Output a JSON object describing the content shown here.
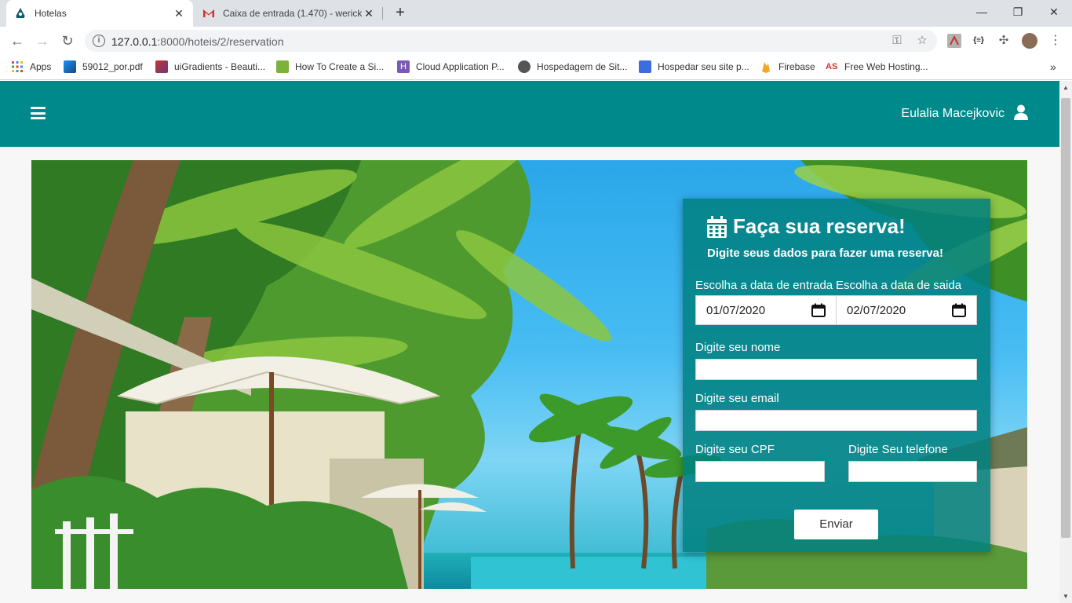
{
  "browser": {
    "tabs": [
      {
        "title": "Hotelas",
        "icon": "hotel-favicon-icon",
        "active": true
      },
      {
        "title": "Caixa de entrada (1.470) - werick",
        "icon": "gmail-favicon-icon",
        "active": false
      }
    ],
    "new_tab": "+",
    "url": {
      "host": "127.0.0.1",
      "rest": ":8000/hoteis/2/reservation"
    },
    "bookmarks": [
      {
        "label": "Apps",
        "icon": "apps-grid-icon"
      },
      {
        "label": "59012_por.pdf",
        "icon": "pdf-icon",
        "color": "#2b7bb9"
      },
      {
        "label": "uiGradients - Beauti...",
        "icon": "uigradients-icon",
        "color": "#a23a8a"
      },
      {
        "label": "How To Create a Si...",
        "icon": "site-icon",
        "color": "#7bb33a"
      },
      {
        "label": "Cloud Application P...",
        "icon": "heroku-icon",
        "color": "#7a5ab5"
      },
      {
        "label": "Hospedagem de Sit...",
        "icon": "globe-icon",
        "color": "#555555"
      },
      {
        "label": "Hospedar seu site p...",
        "icon": "hosting-icon",
        "color": "#3d6be0"
      },
      {
        "label": "Firebase",
        "icon": "firebase-icon",
        "color": "#f5a623"
      },
      {
        "label": "Free Web Hosting...",
        "icon": "awardspace-icon",
        "color": "#d9302c"
      }
    ],
    "more_bookmarks": "»"
  },
  "app": {
    "nav": {
      "menu_icon": "hamburger-icon",
      "username": "Eulalia Macejkovic",
      "user_icon": "user-icon",
      "color": "#00898a"
    },
    "reservation": {
      "title": "Faça sua reserva!",
      "subtitle": "Digite seus dados para fazer uma reserva!",
      "checkin_label": "Escolha a data de entrada",
      "checkin_value": "01/07/2020",
      "checkout_label": "Escolha a data de saida",
      "checkout_value": "02/07/2020",
      "name_label": "Digite seu nome",
      "name_value": "",
      "email_label": "Digite seu email",
      "email_value": "",
      "cpf_label": "Digite seu CPF",
      "cpf_value": "",
      "phone_label": "Digite Seu telefone",
      "phone_value": "",
      "submit_label": "Enviar"
    }
  }
}
